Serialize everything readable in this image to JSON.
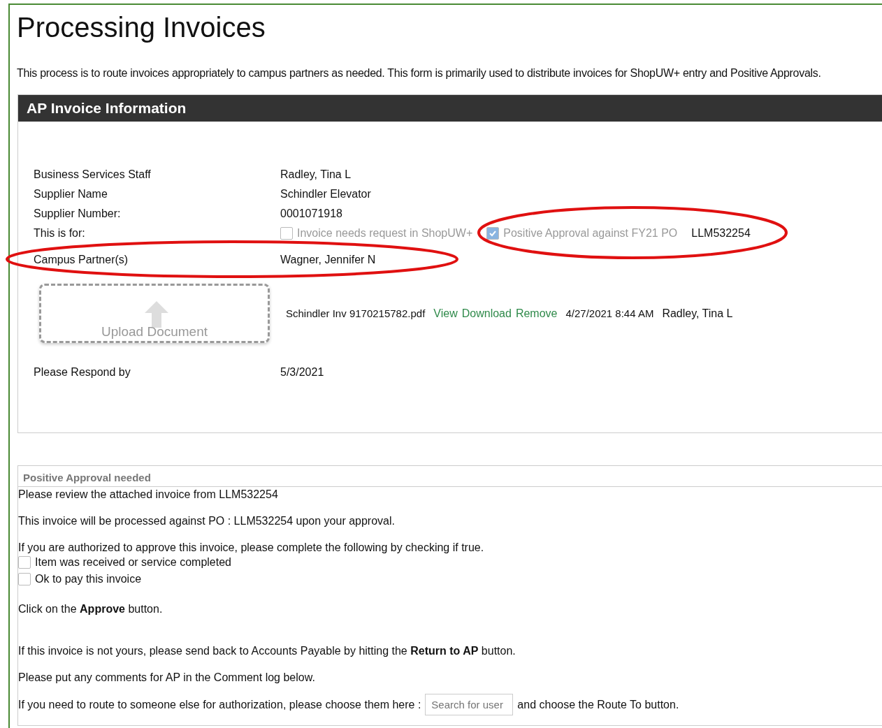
{
  "page": {
    "title": "Processing Invoices",
    "intro": "This process is to route invoices appropriately to campus partners as needed. This form is primarily used to distribute invoices for ShopUW+ entry and Positive Approvals."
  },
  "invoice_panel": {
    "title": "AP Invoice Information",
    "fields": [
      {
        "label": "Business Services Staff",
        "value": "Radley, Tina L"
      },
      {
        "label": "Supplier Name",
        "value": "Schindler Elevator"
      },
      {
        "label": "Supplier Number:",
        "value": "0001071918"
      }
    ],
    "this_is_for": {
      "label": "This is for:",
      "options": [
        {
          "label": "Invoice needs request in ShopUW+",
          "checked": false
        },
        {
          "label": "Positive Approval against FY21 PO",
          "checked": true
        }
      ],
      "po": "LLM532254"
    },
    "campus_partner": {
      "label": "Campus Partner(s)",
      "value": "Wagner, Jennifer N"
    },
    "upload_button": "Upload Document",
    "attachment": {
      "file": "Schindler Inv 9170215782.pdf",
      "actions": [
        "View",
        "Download",
        "Remove"
      ],
      "date": "4/27/2021 8:44 AM",
      "by": "Radley, Tina L"
    },
    "respond": {
      "label": "Please Respond by",
      "value": "5/3/2021"
    }
  },
  "approval_panel": {
    "title": "Positive Approval needed",
    "lines": [
      "Please review the attached invoice from LLM532254",
      "This invoice will be processed against PO : LLM532254 upon your approval.",
      "If you are authorized to approve this invoice, please complete the following by checking if true."
    ],
    "checks": [
      {
        "label": "Item was received or service completed",
        "checked": false
      },
      {
        "label": "Ok to pay this invoice",
        "checked": false
      }
    ],
    "approve_line": "Click on the **Approve** button.",
    "return_line": "If this invoice is not yours, please send back to Accounts Payable by hitting the **Return to AP** button.",
    "comment_line": "Please put any comments for AP in the Comment log below.",
    "route": {
      "before": "If you need to route to someone else for authorization, please choose them here :",
      "placeholder": "Search for user",
      "after": "and choose the Route To button."
    }
  },
  "annotations": [
    {
      "kind": "ellipse"
    },
    {
      "kind": "ellipse"
    }
  ]
}
